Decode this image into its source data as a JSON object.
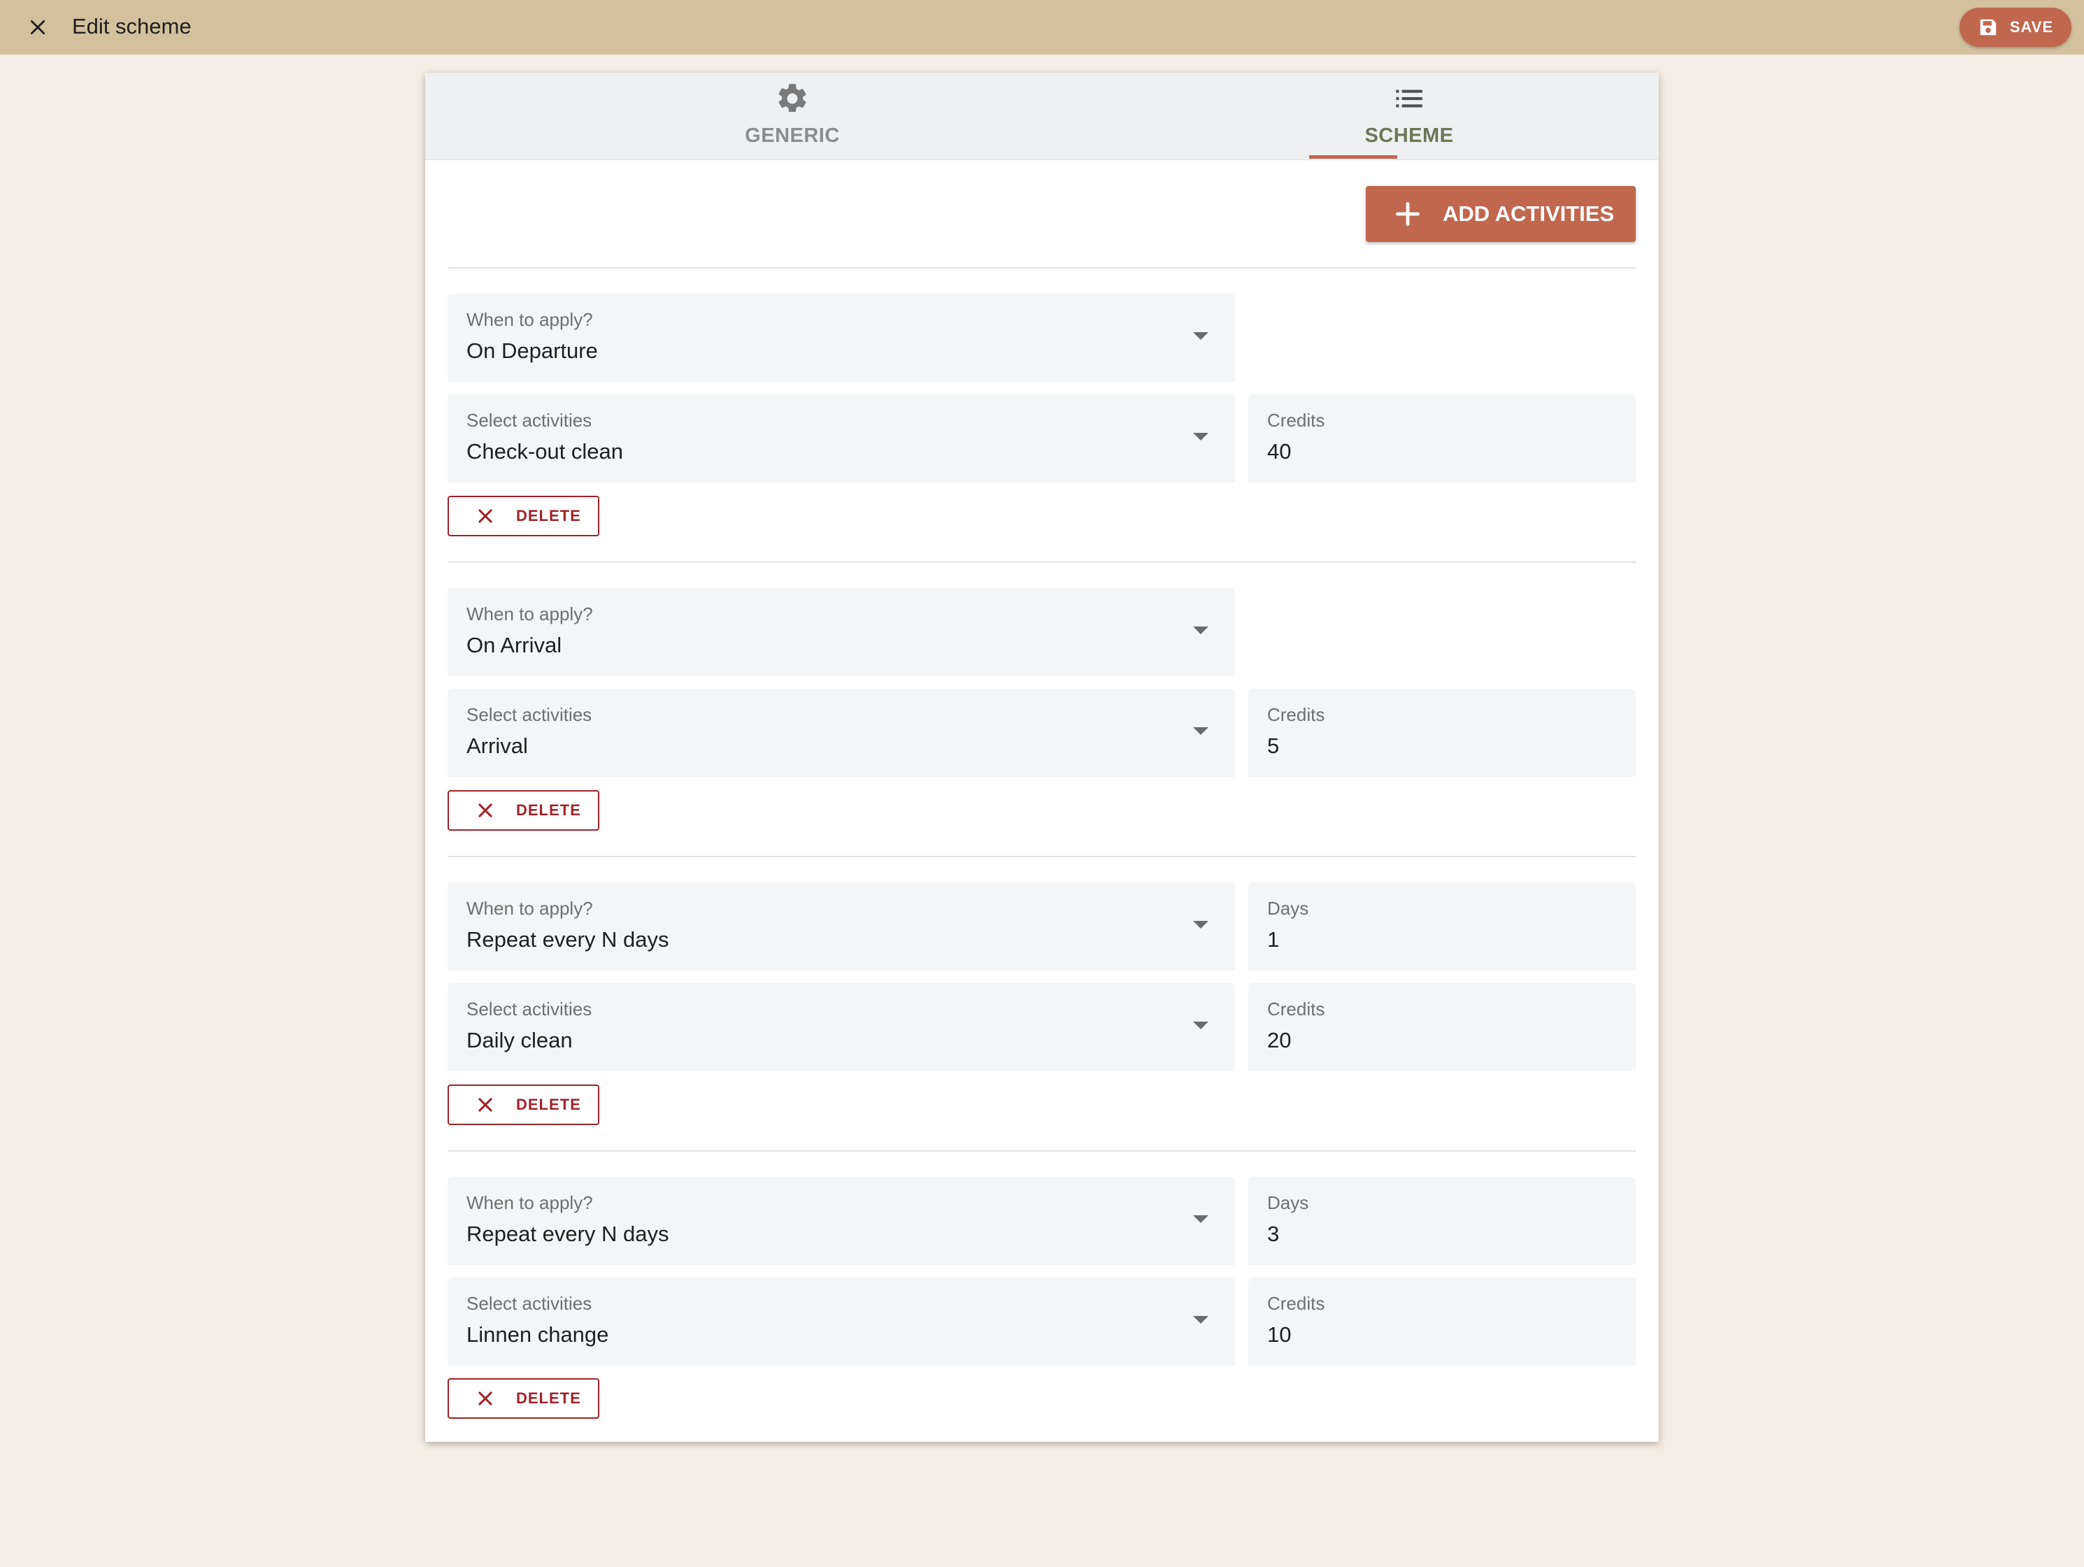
{
  "topbar": {
    "title": "Edit scheme",
    "save_label": "SAVE"
  },
  "tabs": [
    {
      "label": "GENERIC",
      "icon": "gear-icon",
      "active": false
    },
    {
      "label": "SCHEME",
      "icon": "list-icon",
      "active": true
    }
  ],
  "add_activities_label": "ADD ACTIVITIES",
  "rules": [
    {
      "when_label": "When to apply?",
      "when_value": "On Departure",
      "activities_label": "Select activities",
      "activities_value": "Check-out clean",
      "credits_label": "Credits",
      "credits_value": "40",
      "delete_label": "DELETE"
    },
    {
      "when_label": "When to apply?",
      "when_value": "On Arrival",
      "activities_label": "Select activities",
      "activities_value": "Arrival",
      "credits_label": "Credits",
      "credits_value": "5",
      "delete_label": "DELETE"
    },
    {
      "when_label": "When to apply?",
      "when_value": "Repeat every N days",
      "days_label": "Days",
      "days_value": "1",
      "activities_label": "Select activities",
      "activities_value": "Daily clean",
      "credits_label": "Credits",
      "credits_value": "20",
      "delete_label": "DELETE"
    },
    {
      "when_label": "When to apply?",
      "when_value": "Repeat every N days",
      "days_label": "Days",
      "days_value": "3",
      "activities_label": "Select activities",
      "activities_value": "Linnen change",
      "credits_label": "Credits",
      "credits_value": "10",
      "delete_label": "DELETE"
    }
  ],
  "colors": {
    "topbar": "#d3c09d",
    "background": "#f5ede3",
    "accent": "#c1674d",
    "danger": "#a0232a"
  }
}
